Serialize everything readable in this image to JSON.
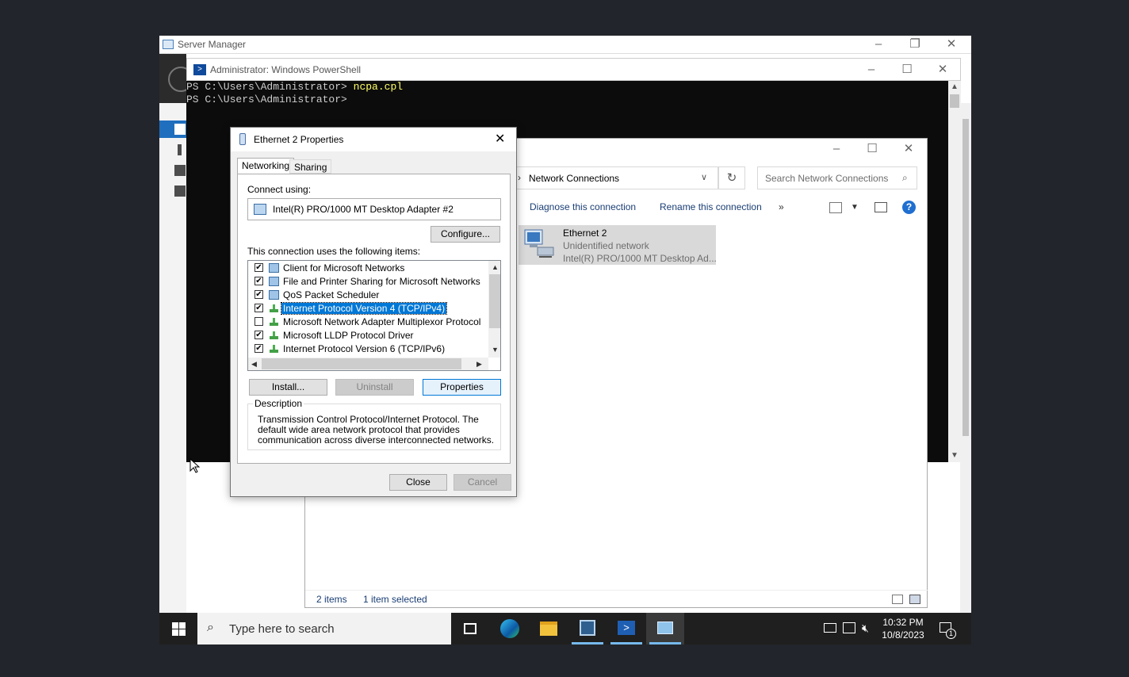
{
  "server_manager": {
    "title": "Server Manager"
  },
  "powershell": {
    "title": "Administrator: Windows PowerShell",
    "lines": [
      {
        "prompt": "PS C:\\Users\\Administrator> ",
        "command": "ncpa.cpl"
      },
      {
        "prompt": "PS C:\\Users\\Administrator> ",
        "command": ""
      }
    ]
  },
  "network_connections": {
    "address": "Network Connections",
    "search_placeholder": "Search Network Connections",
    "commands": [
      "Diagnose this connection",
      "Rename this connection",
      "»"
    ],
    "item": {
      "name": "Ethernet 2",
      "status": "Unidentified network",
      "device": "Intel(R) PRO/1000 MT Desktop Ad..."
    },
    "status_bar": {
      "count": "2 items",
      "selected": "1 item selected"
    }
  },
  "dialog": {
    "title": "Ethernet 2 Properties",
    "tabs": [
      "Networking",
      "Sharing"
    ],
    "connect_using_label": "Connect using:",
    "adapter": "Intel(R) PRO/1000 MT Desktop Adapter #2",
    "configure_label": "Configure...",
    "items_label": "This connection uses the following items:",
    "items": [
      {
        "label": "Client for Microsoft Networks",
        "checked": true,
        "icon": "monitor-icon",
        "selected": false
      },
      {
        "label": "File and Printer Sharing for Microsoft Networks",
        "checked": true,
        "icon": "monitor-icon",
        "selected": false
      },
      {
        "label": "QoS Packet Scheduler",
        "checked": true,
        "icon": "monitor-icon",
        "selected": false
      },
      {
        "label": "Internet Protocol Version 4 (TCP/IPv4)",
        "checked": true,
        "icon": "network-protocol-icon",
        "selected": true
      },
      {
        "label": "Microsoft Network Adapter Multiplexor Protocol",
        "checked": false,
        "icon": "network-protocol-icon",
        "selected": false
      },
      {
        "label": "Microsoft LLDP Protocol Driver",
        "checked": true,
        "icon": "network-protocol-icon",
        "selected": false
      },
      {
        "label": "Internet Protocol Version 6 (TCP/IPv6)",
        "checked": true,
        "icon": "network-protocol-icon",
        "selected": false
      }
    ],
    "install_label": "Install...",
    "uninstall_label": "Uninstall",
    "properties_label": "Properties",
    "description_label": "Description",
    "description": "Transmission Control Protocol/Internet Protocol. The default wide area network protocol that provides communication across diverse interconnected networks.",
    "close_label": "Close",
    "cancel_label": "Cancel"
  },
  "taskbar": {
    "search_placeholder": "Type here to search",
    "time": "10:32 PM",
    "date": "10/8/2023",
    "notification_count": "1"
  },
  "colors": {
    "accent": "#0078d7",
    "taskbar": "#1f1f1f",
    "powershell_bg": "#0c0c0c"
  }
}
